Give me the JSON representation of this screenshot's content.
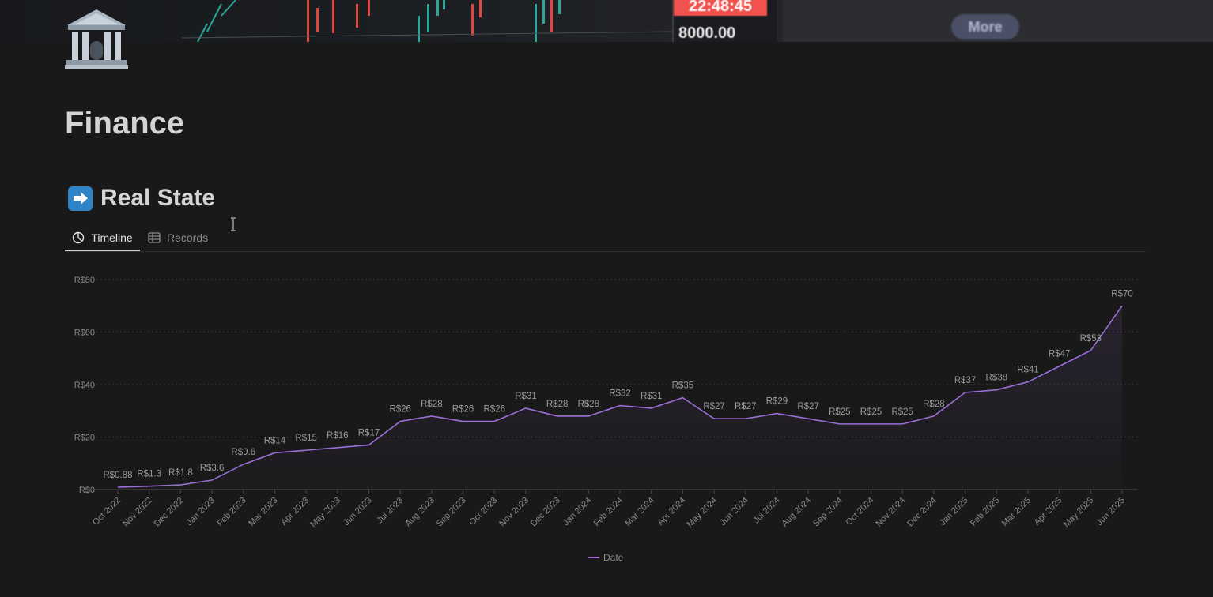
{
  "cover": {
    "clock": "22:48:45",
    "price": "8000.00",
    "button": "More"
  },
  "page": {
    "icon": "bank-building-icon",
    "title": "Finance"
  },
  "database": {
    "icon": "right-arrow-icon",
    "title": "Real State",
    "tabs": [
      {
        "label": "Timeline",
        "icon": "chart-pie-icon",
        "active": true
      },
      {
        "label": "Records",
        "icon": "table-icon",
        "active": false
      }
    ]
  },
  "colors": {
    "line": "#9b6fd6",
    "background": "#191919",
    "grid": "#3a3a3a"
  },
  "chart_data": {
    "type": "line",
    "x": [
      "Oct 2022",
      "Nov 2022",
      "Dec 2022",
      "Jan 2023",
      "Feb 2023",
      "Mar 2023",
      "Apr 2023",
      "May 2023",
      "Jun 2023",
      "Jul 2023",
      "Aug 2023",
      "Sep 2023",
      "Oct 2023",
      "Nov 2023",
      "Dec 2023",
      "Jan 2024",
      "Feb 2024",
      "Mar 2024",
      "Apr 2024",
      "May 2024",
      "Jun 2024",
      "Jul 2024",
      "Aug 2024",
      "Sep 2024",
      "Oct 2024",
      "Nov 2024",
      "Dec 2024",
      "Jan 2025",
      "Feb 2025",
      "Mar 2025",
      "Apr 2025",
      "May 2025",
      "Jun 2025"
    ],
    "values": [
      0.88,
      1.3,
      1.8,
      3.6,
      9.6,
      14,
      15,
      16,
      17,
      26,
      28,
      26,
      26,
      31,
      28,
      28,
      32,
      31,
      35,
      27,
      27,
      29,
      27,
      25,
      25,
      25,
      28,
      37,
      38,
      41,
      47,
      53,
      70
    ],
    "labels": [
      "R$0.88",
      "R$1.3",
      "R$1.8",
      "R$3.6",
      "R$9.6",
      "R$14",
      "R$15",
      "R$16",
      "R$17",
      "R$26",
      "R$28",
      "R$26",
      "R$26",
      "R$31",
      "R$28",
      "R$28",
      "R$32",
      "R$31",
      "R$35",
      "R$27",
      "R$27",
      "R$29",
      "R$27",
      "R$25",
      "R$25",
      "R$25",
      "R$28",
      "R$37",
      "R$38",
      "R$41",
      "R$47",
      "R$53",
      "R$70"
    ],
    "yticks": [
      0,
      20,
      40,
      60,
      80
    ],
    "ytick_labels": [
      "R$0",
      "R$20",
      "R$40",
      "R$60",
      "R$80"
    ],
    "ylim": [
      0,
      80
    ],
    "grid": true,
    "legend": {
      "position": "bottom",
      "entries": [
        "Date"
      ]
    }
  }
}
